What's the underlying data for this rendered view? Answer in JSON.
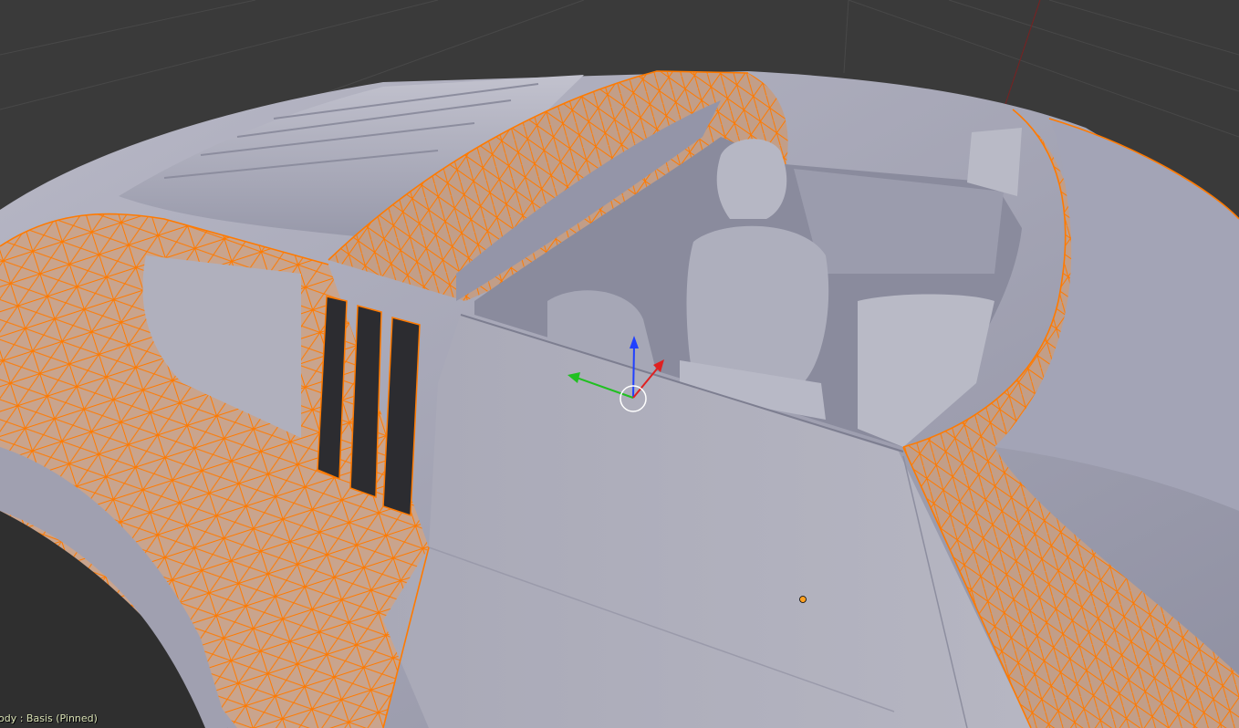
{
  "viewport": {
    "object_info": "ody : Basis (Pinned)",
    "colors": {
      "background": "#3a3a3a",
      "grid_line": "#4a4a4a",
      "mesh_surface": "#a6a6b6",
      "mesh_shadow": "#7f8092",
      "selected_face": "#c9a48d",
      "selected_edge": "#ff7a00",
      "gizmo_x": "#e02020",
      "gizmo_y": "#20c020",
      "gizmo_z": "#2040ff",
      "origin_dot": "#ffa020",
      "status_text": "#d8e0b4"
    },
    "icons": [
      "3d-cursor-icon",
      "transform-gizmo-icon",
      "object-origin-icon"
    ]
  }
}
